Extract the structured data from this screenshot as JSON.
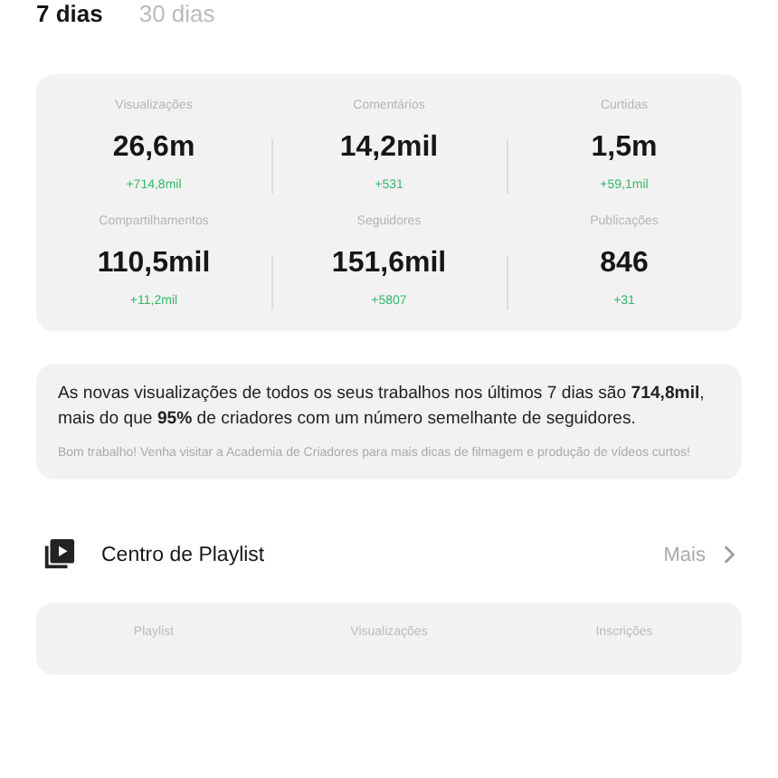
{
  "tabs": [
    {
      "label": "7 dias",
      "selected": true
    },
    {
      "label": "30 dias",
      "selected": false
    }
  ],
  "stats": [
    {
      "label": "Visualizações",
      "value": "26,6m",
      "delta": "+714,8mil"
    },
    {
      "label": "Comentários",
      "value": "14,2mil",
      "delta": "+531"
    },
    {
      "label": "Curtidas",
      "value": "1,5m",
      "delta": "+59,1mil"
    },
    {
      "label": "Compartilhamentos",
      "value": "110,5mil",
      "delta": "+11,2mil"
    },
    {
      "label": "Seguidores",
      "value": "151,6mil",
      "delta": "+5807"
    },
    {
      "label": "Publicações",
      "value": "846",
      "delta": "+31"
    }
  ],
  "summary": {
    "headline": "As novas visualizações de todos os seus trabalhos nos últimos 7 dias são **714,8mil**, mais do que **95%** de criadores com um número semelhante de seguidores.",
    "tip": "Bom trabalho! Venha visitar a Academia de Criadores para mais dicas de filmagem e produção de vídeos curtos!"
  },
  "playlist_center": {
    "title": "Centro de Playlist",
    "more": "Mais",
    "columns": [
      "Playlist",
      "Visualizações",
      "Inscrições"
    ]
  }
}
